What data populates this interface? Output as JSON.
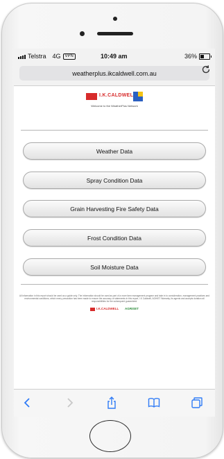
{
  "status_bar": {
    "carrier": "Telstra",
    "network": "4G",
    "vpn_label": "VPN",
    "time": "10:49 am",
    "battery_percent": "36%"
  },
  "browser": {
    "url": "weatherplus.ikcaldwell.com.au",
    "reload_icon": "reload-icon"
  },
  "page": {
    "logo_text": "I.K.CALDWELL",
    "tagline": "Welcome to the WeatherPlus Network",
    "buttons": [
      {
        "label": "Weather Data"
      },
      {
        "label": "Spray Condition Data"
      },
      {
        "label": "Grain Harvesting Fire Safety Data"
      },
      {
        "label": "Frost Condition Data"
      },
      {
        "label": "Soil Moisture Data"
      }
    ],
    "disclaimer": "All information in this report should be used as a guide only. The information should be used as part of a more farm management program and take in to consideration, management practices and environmental conditions, which every precaution has been made to ensure the accuracy of statements in this report, I.K Caldwell, AGHIST Warranty, its agents and accepts duration all responsibilities for the subsequent guaranteed.",
    "footer_logo_1": "I.K.CALDWELL",
    "footer_logo_2": "AGRISET"
  },
  "toolbar": {
    "icons": [
      "back-icon",
      "forward-icon",
      "share-icon",
      "bookmarks-icon",
      "tabs-icon"
    ]
  },
  "colors": {
    "accent_blue": "#2f7bf6",
    "brand_red": "#d72b2b"
  }
}
